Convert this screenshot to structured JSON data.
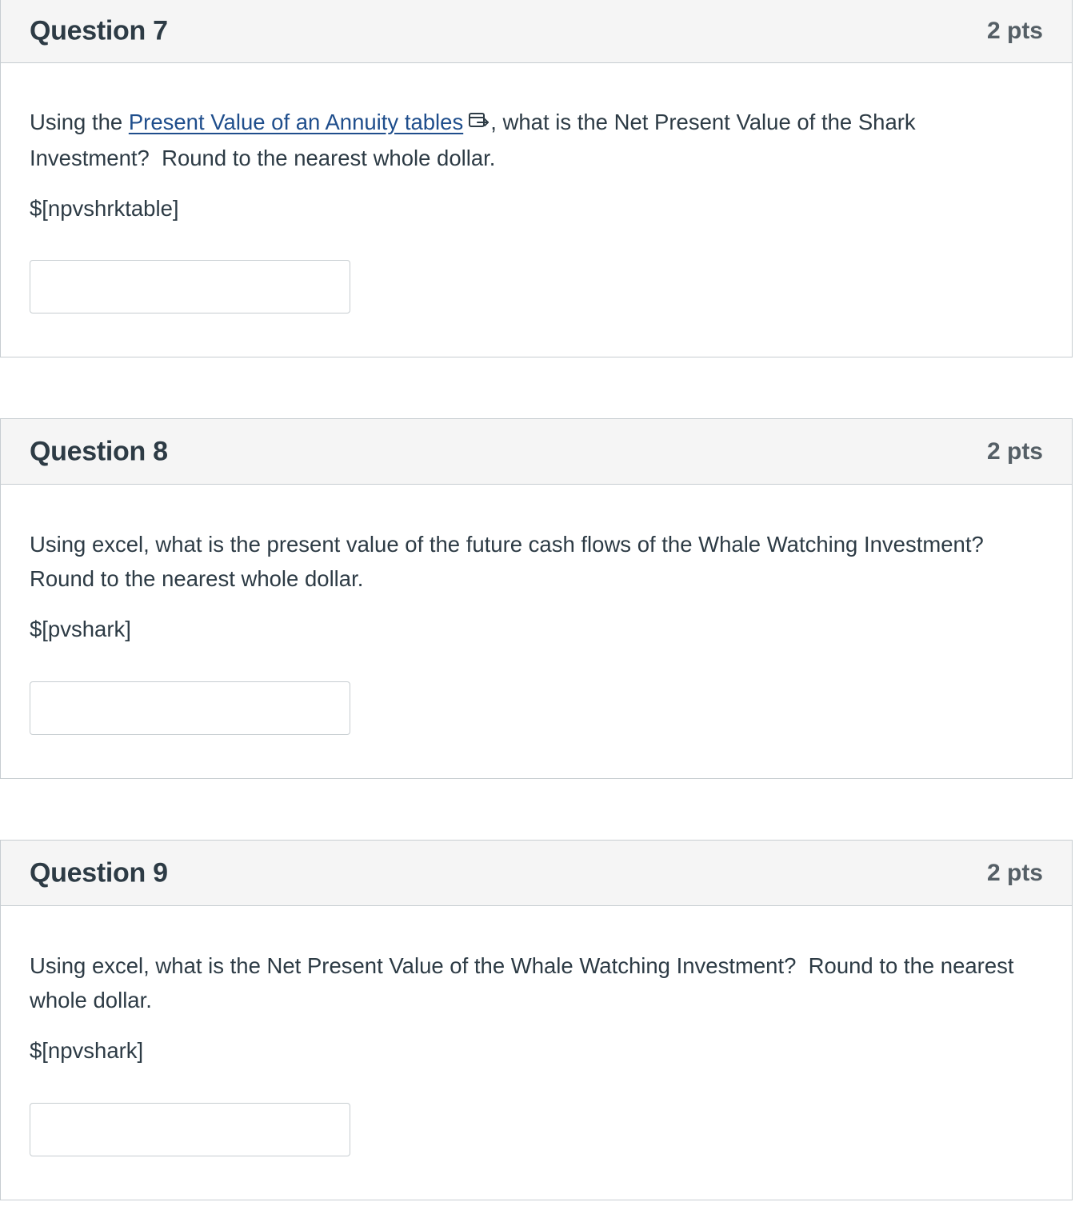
{
  "questions": [
    {
      "title": "Question 7",
      "points": "2 pts",
      "text_before_link": "Using the ",
      "link_text": "Present Value of an Annuity tables",
      "text_after_link": ", what is the Net Present Value of the Shark\nInvestment?  Round to the nearest whole dollar.",
      "placeholder_token": "$[npvshrktable]",
      "answer_value": ""
    },
    {
      "title": "Question 8",
      "points": "2 pts",
      "text": "Using excel, what is the present value of the future cash flows of the Whale Watching Investment?\nRound to the nearest whole dollar.",
      "placeholder_token": "$[pvshark]",
      "answer_value": ""
    },
    {
      "title": "Question 9",
      "points": "2 pts",
      "text": "Using excel, what is the Net Present Value of the Whale Watching Investment?  Round to the nearest\nwhole dollar.",
      "placeholder_token": "$[npvshark]",
      "answer_value": ""
    }
  ],
  "icons": {
    "external_link": "external-link-icon"
  },
  "colors": {
    "header_bg": "#f5f5f5",
    "border": "#c7cdd1",
    "text": "#2d3b45",
    "points": "#555f66",
    "link": "#1f4e8c"
  }
}
